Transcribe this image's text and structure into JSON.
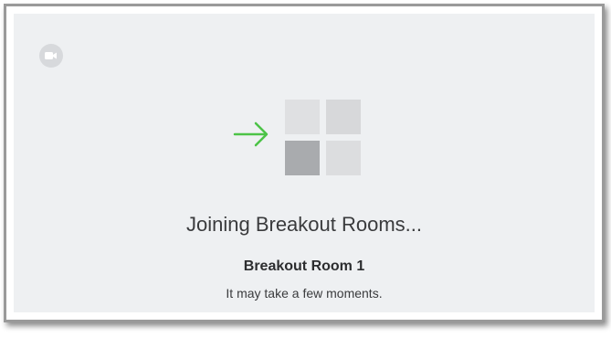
{
  "dialog": {
    "title": "Joining Breakout Rooms...",
    "room_name": "Breakout Room 1",
    "note": "It may take a few moments."
  },
  "icons": {
    "camera": "video-camera-icon",
    "arrow": "arrow-right-icon",
    "rooms": "breakout-rooms-grid-icon"
  },
  "colors": {
    "background": "#eef0f2",
    "arrow": "#4cc347",
    "tile_light": "#d9dadc",
    "tile_dark": "#a9abae"
  }
}
